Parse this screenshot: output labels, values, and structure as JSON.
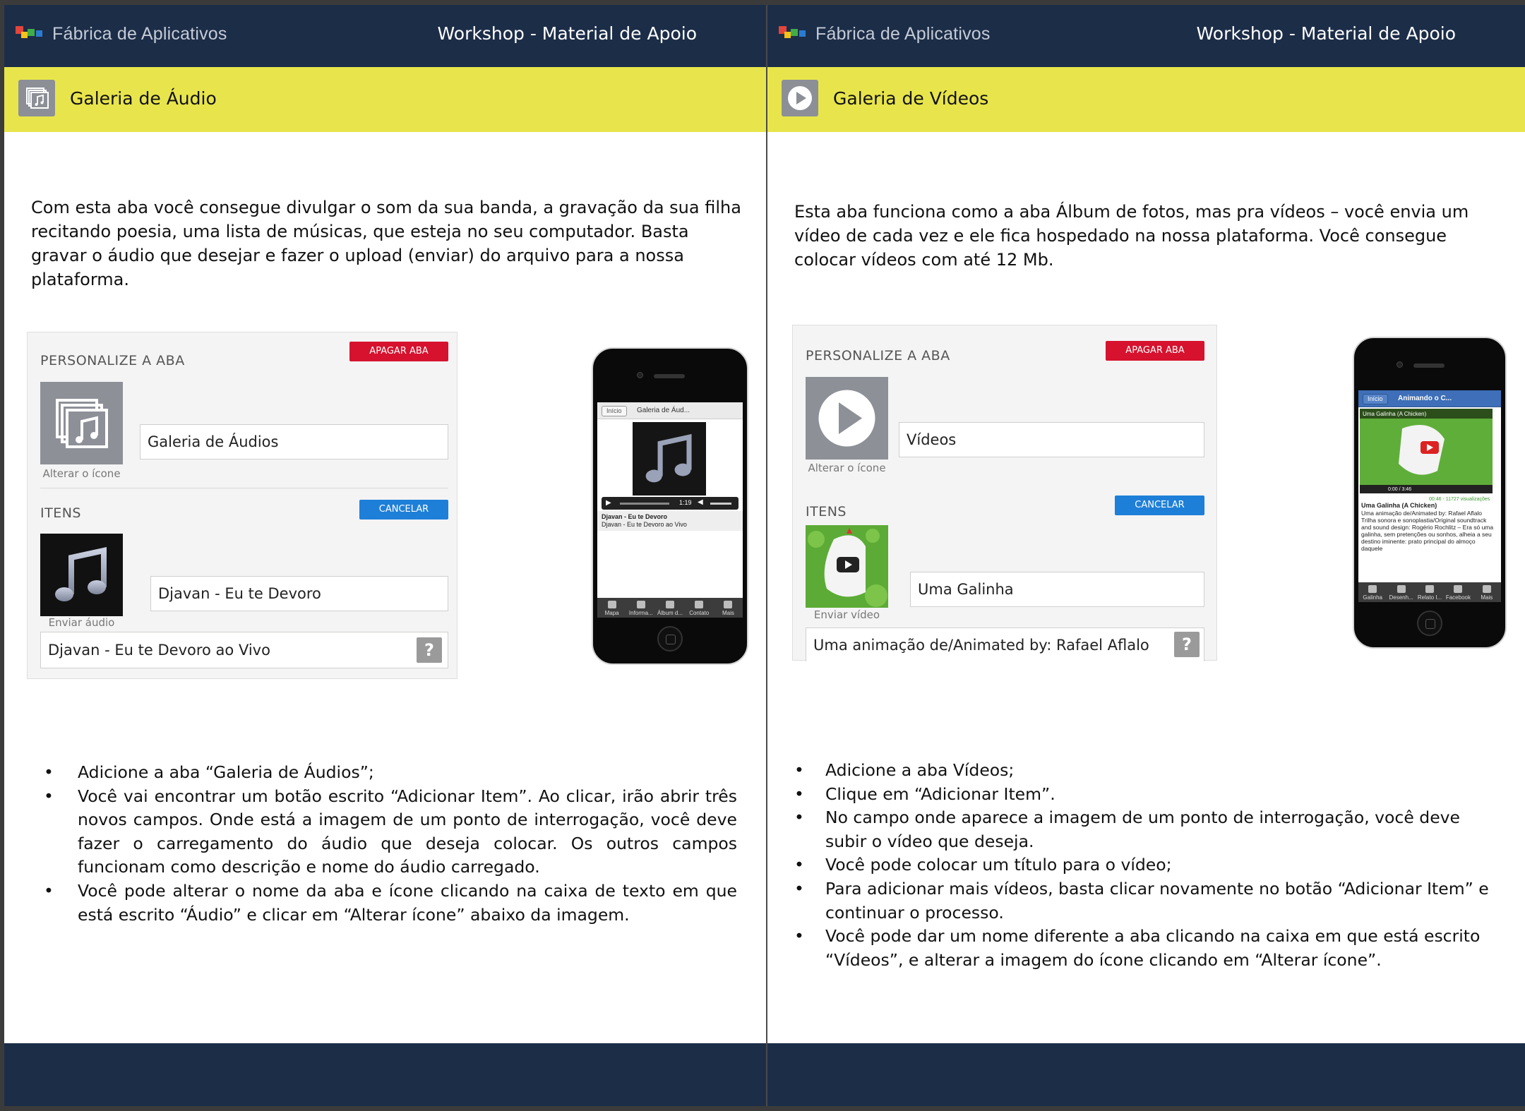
{
  "brand": "Fábrica de Aplicativos",
  "header_title": "Workshop - Material de Apoio",
  "colors": {
    "navy": "#1c2d48",
    "yellow": "#e8e54c",
    "red": "#d6122e",
    "blue": "#1e7fd8"
  },
  "left": {
    "section_title": "Galeria de Áudio",
    "section_icon": "audio-gallery-icon",
    "intro": "Com esta aba você consegue divulgar o som da sua banda, a gravação da sua filha recitando poesia, uma lista de músicas, que esteja no seu computador. Basta gravar o áudio que desejar e fazer o upload (enviar) do arquivo para a nossa plataforma.",
    "panel": {
      "personalize_label": "PERSONALIZE A ABA",
      "delete_button": "APAGAR ABA",
      "tab_name_value": "Galeria de Áudios",
      "change_icon_caption": "Alterar o ícone",
      "items_label": "ITENS",
      "cancel_button": "CANCELAR",
      "item_title_value": "Djavan - Eu te Devoro",
      "send_caption": "Enviar áudio",
      "item_description_value": "Djavan - Eu te Devoro ao Vivo",
      "help_glyph": "?"
    },
    "phone": {
      "back_label": "Início",
      "nav_title": "Galeria de Áud...",
      "time": "1:19",
      "track_title": "Djavan - Eu te Devoro",
      "track_subtitle": "Djavan - Eu te Devoro ao Vivo",
      "tabs": [
        "Mapa",
        "Informa...",
        "Álbum d...",
        "Contato",
        "Mais"
      ]
    },
    "bullets": [
      "Adicione a aba “Galeria de Áudios”;",
      "Você vai encontrar um botão escrito “Adicionar Item”. Ao clicar, irão abrir três novos campos. Onde está a imagem de um ponto de interrogação, você deve fazer o carregamento do áudio que deseja colocar. Os outros campos funcionam como descrição e nome do áudio carregado.",
      "Você pode alterar o nome da aba e ícone clicando na caixa de texto em que está escrito  “Áudio”  e clicar em “Alterar ícone” abaixo da imagem."
    ]
  },
  "right": {
    "section_title": "Galeria de Vídeos",
    "section_icon": "play-icon",
    "intro": "Esta aba funciona como a aba Álbum de fotos, mas pra vídeos – você envia um vídeo de cada vez e ele fica hospedado na nossa plataforma. Você consegue colocar vídeos com até 12 Mb.",
    "panel": {
      "personalize_label": "PERSONALIZE A ABA",
      "delete_button": "APAGAR ABA",
      "tab_name_value": "Vídeos",
      "change_icon_caption": "Alterar o ícone",
      "items_label": "ITENS",
      "cancel_button": "CANCELAR",
      "item_title_value": "Uma Galinha",
      "send_caption": "Enviar vídeo",
      "item_description_value": "Uma animação de/Animated by: Rafael Aflalo",
      "help_glyph": "?"
    },
    "phone": {
      "back_label": "Início",
      "nav_title": "Animando o C...",
      "video_title": "Uma Galinha (A Chicken)",
      "video_time": "0:00 / 3:46",
      "views": "00:46 - 11727 visualizações",
      "desc_title": "Uma Galinha (A Chicken)",
      "desc_body": "Uma animação de/Animated by: Rafael Aflalo Trilha sonora e sonoplastia/Original soundtrack and sound design: Rogério Rochlitz – Era só uma galinha, sem pretenções ou sonhos, alheia a seu destino iminente: prato principal do almoço daquele",
      "tabs": [
        "Galinha",
        "Desenh...",
        "Relato I...",
        "Facebook",
        "Mais"
      ]
    },
    "bullets": [
      "Adicione a aba Vídeos;",
      "Clique em “Adicionar Item”.",
      "No campo onde aparece a imagem de um ponto de interrogação, você deve subir o vídeo que deseja.",
      "Você pode colocar um título para o vídeo;",
      "Para adicionar mais vídeos, basta clicar novamente no botão “Adicionar Item” e continuar o processo.",
      "Você pode dar um nome diferente a aba clicando na caixa em que está escrito “Vídeos”, e alterar a imagem do ícone clicando em “Alterar ícone”."
    ]
  }
}
